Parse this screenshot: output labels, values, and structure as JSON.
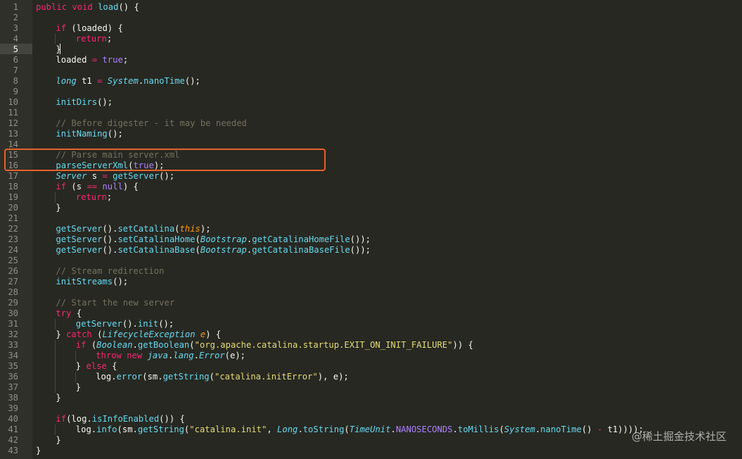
{
  "editor": {
    "active_line": 5,
    "highlight_lines": [
      15,
      16
    ],
    "watermark": "@稀土掘金技术社区",
    "lines": [
      {
        "n": "1",
        "indent": 0,
        "tokens": [
          [
            "kw",
            "public"
          ],
          [
            "pl",
            " "
          ],
          [
            "kw",
            "void"
          ],
          [
            "pl",
            " "
          ],
          [
            "fn",
            "load"
          ],
          [
            "pl",
            "() {"
          ]
        ]
      },
      {
        "n": "2",
        "indent": 0,
        "tokens": []
      },
      {
        "n": "3",
        "indent": 1,
        "tokens": [
          [
            "kw",
            "if"
          ],
          [
            "pl",
            " (loaded) {"
          ]
        ]
      },
      {
        "n": "4",
        "indent": 2,
        "tokens": [
          [
            "kw",
            "return"
          ],
          [
            "pl",
            ";"
          ]
        ]
      },
      {
        "n": "5",
        "indent": 1,
        "tokens": [
          [
            "pl",
            "}"
          ]
        ]
      },
      {
        "n": "6",
        "indent": 1,
        "tokens": [
          [
            "pl",
            "loaded "
          ],
          [
            "kw",
            "="
          ],
          [
            "pl",
            " "
          ],
          [
            "cn",
            "true"
          ],
          [
            "pl",
            ";"
          ]
        ]
      },
      {
        "n": "7",
        "indent": 0,
        "tokens": []
      },
      {
        "n": "8",
        "indent": 1,
        "tokens": [
          [
            "st",
            "long"
          ],
          [
            "pl",
            " t1 "
          ],
          [
            "kw",
            "="
          ],
          [
            "pl",
            " "
          ],
          [
            "st",
            "System"
          ],
          [
            "pl",
            "."
          ],
          [
            "fn",
            "nanoTime"
          ],
          [
            "pl",
            "();"
          ]
        ]
      },
      {
        "n": "9",
        "indent": 0,
        "tokens": []
      },
      {
        "n": "10",
        "indent": 1,
        "tokens": [
          [
            "fn",
            "initDirs"
          ],
          [
            "pl",
            "();"
          ]
        ]
      },
      {
        "n": "11",
        "indent": 0,
        "tokens": []
      },
      {
        "n": "12",
        "indent": 1,
        "tokens": [
          [
            "cm",
            "// Before digester - it may be needed"
          ]
        ]
      },
      {
        "n": "13",
        "indent": 1,
        "tokens": [
          [
            "fn",
            "initNaming"
          ],
          [
            "pl",
            "();"
          ]
        ]
      },
      {
        "n": "14",
        "indent": 0,
        "tokens": []
      },
      {
        "n": "15",
        "indent": 1,
        "tokens": [
          [
            "cm",
            "// Parse main server.xml"
          ]
        ]
      },
      {
        "n": "16",
        "indent": 1,
        "tokens": [
          [
            "fn",
            "parseServerXml"
          ],
          [
            "pl",
            "("
          ],
          [
            "cn",
            "true"
          ],
          [
            "pl",
            ");"
          ]
        ]
      },
      {
        "n": "17",
        "indent": 1,
        "tokens": [
          [
            "st",
            "Server"
          ],
          [
            "pl",
            " s "
          ],
          [
            "kw",
            "="
          ],
          [
            "pl",
            " "
          ],
          [
            "fn",
            "getServer"
          ],
          [
            "pl",
            "();"
          ]
        ]
      },
      {
        "n": "18",
        "indent": 1,
        "tokens": [
          [
            "kw",
            "if"
          ],
          [
            "pl",
            " (s "
          ],
          [
            "kw",
            "=="
          ],
          [
            "pl",
            " "
          ],
          [
            "cn",
            "null"
          ],
          [
            "pl",
            ") {"
          ]
        ]
      },
      {
        "n": "19",
        "indent": 2,
        "tokens": [
          [
            "kw",
            "return"
          ],
          [
            "pl",
            ";"
          ]
        ]
      },
      {
        "n": "20",
        "indent": 1,
        "tokens": [
          [
            "pl",
            "}"
          ]
        ]
      },
      {
        "n": "21",
        "indent": 0,
        "tokens": []
      },
      {
        "n": "22",
        "indent": 1,
        "tokens": [
          [
            "fn",
            "getServer"
          ],
          [
            "pl",
            "()."
          ],
          [
            "fn",
            "setCatalina"
          ],
          [
            "pl",
            "("
          ],
          [
            "pr",
            "this"
          ],
          [
            "pl",
            ");"
          ]
        ]
      },
      {
        "n": "23",
        "indent": 1,
        "tokens": [
          [
            "fn",
            "getServer"
          ],
          [
            "pl",
            "()."
          ],
          [
            "fn",
            "setCatalinaHome"
          ],
          [
            "pl",
            "("
          ],
          [
            "st",
            "Bootstrap"
          ],
          [
            "pl",
            "."
          ],
          [
            "fn",
            "getCatalinaHomeFile"
          ],
          [
            "pl",
            "());"
          ]
        ]
      },
      {
        "n": "24",
        "indent": 1,
        "tokens": [
          [
            "fn",
            "getServer"
          ],
          [
            "pl",
            "()."
          ],
          [
            "fn",
            "setCatalinaBase"
          ],
          [
            "pl",
            "("
          ],
          [
            "st",
            "Bootstrap"
          ],
          [
            "pl",
            "."
          ],
          [
            "fn",
            "getCatalinaBaseFile"
          ],
          [
            "pl",
            "());"
          ]
        ]
      },
      {
        "n": "25",
        "indent": 0,
        "tokens": []
      },
      {
        "n": "26",
        "indent": 1,
        "tokens": [
          [
            "cm",
            "// Stream redirection"
          ]
        ]
      },
      {
        "n": "27",
        "indent": 1,
        "tokens": [
          [
            "fn",
            "initStreams"
          ],
          [
            "pl",
            "();"
          ]
        ]
      },
      {
        "n": "28",
        "indent": 0,
        "tokens": []
      },
      {
        "n": "29",
        "indent": 1,
        "tokens": [
          [
            "cm",
            "// Start the new server"
          ]
        ]
      },
      {
        "n": "30",
        "indent": 1,
        "tokens": [
          [
            "kw",
            "try"
          ],
          [
            "pl",
            " {"
          ]
        ]
      },
      {
        "n": "31",
        "indent": 2,
        "tokens": [
          [
            "fn",
            "getServer"
          ],
          [
            "pl",
            "()."
          ],
          [
            "fn",
            "init"
          ],
          [
            "pl",
            "();"
          ]
        ]
      },
      {
        "n": "32",
        "indent": 1,
        "tokens": [
          [
            "pl",
            "} "
          ],
          [
            "kw",
            "catch"
          ],
          [
            "pl",
            " ("
          ],
          [
            "st",
            "LifecycleException"
          ],
          [
            "pl",
            " "
          ],
          [
            "pr",
            "e"
          ],
          [
            "pl",
            ") {"
          ]
        ]
      },
      {
        "n": "33",
        "indent": 2,
        "tokens": [
          [
            "kw",
            "if"
          ],
          [
            "pl",
            " ("
          ],
          [
            "st",
            "Boolean"
          ],
          [
            "pl",
            "."
          ],
          [
            "fn",
            "getBoolean"
          ],
          [
            "pl",
            "("
          ],
          [
            "str",
            "\"org.apache.catalina.startup.EXIT_ON_INIT_FAILURE\""
          ],
          [
            "pl",
            ")) {"
          ]
        ]
      },
      {
        "n": "34",
        "indent": 3,
        "tokens": [
          [
            "kw",
            "throw"
          ],
          [
            "pl",
            " "
          ],
          [
            "kw",
            "new"
          ],
          [
            "pl",
            " "
          ],
          [
            "st",
            "java"
          ],
          [
            "pl",
            "."
          ],
          [
            "st",
            "lang"
          ],
          [
            "pl",
            "."
          ],
          [
            "st",
            "Error"
          ],
          [
            "pl",
            "(e);"
          ]
        ]
      },
      {
        "n": "35",
        "indent": 2,
        "tokens": [
          [
            "pl",
            "} "
          ],
          [
            "kw",
            "else"
          ],
          [
            "pl",
            " {"
          ]
        ]
      },
      {
        "n": "36",
        "indent": 3,
        "tokens": [
          [
            "pl",
            "log."
          ],
          [
            "fn",
            "error"
          ],
          [
            "pl",
            "(sm."
          ],
          [
            "fn",
            "getString"
          ],
          [
            "pl",
            "("
          ],
          [
            "str",
            "\"catalina.initError\""
          ],
          [
            "pl",
            "), e);"
          ]
        ]
      },
      {
        "n": "37",
        "indent": 2,
        "tokens": [
          [
            "pl",
            "}"
          ]
        ]
      },
      {
        "n": "38",
        "indent": 1,
        "tokens": [
          [
            "pl",
            "}"
          ]
        ]
      },
      {
        "n": "39",
        "indent": 0,
        "tokens": []
      },
      {
        "n": "40",
        "indent": 1,
        "tokens": [
          [
            "kw",
            "if"
          ],
          [
            "pl",
            "(log."
          ],
          [
            "fn",
            "isInfoEnabled"
          ],
          [
            "pl",
            "()) {"
          ]
        ]
      },
      {
        "n": "41",
        "indent": 2,
        "tokens": [
          [
            "pl",
            "log."
          ],
          [
            "fn",
            "info"
          ],
          [
            "pl",
            "(sm."
          ],
          [
            "fn",
            "getString"
          ],
          [
            "pl",
            "("
          ],
          [
            "str",
            "\"catalina.init\""
          ],
          [
            "pl",
            ", "
          ],
          [
            "st",
            "Long"
          ],
          [
            "pl",
            "."
          ],
          [
            "fn",
            "toString"
          ],
          [
            "pl",
            "("
          ],
          [
            "st",
            "TimeUnit"
          ],
          [
            "pl",
            "."
          ],
          [
            "cn",
            "NANOSECONDS"
          ],
          [
            "pl",
            "."
          ],
          [
            "fn",
            "toMillis"
          ],
          [
            "pl",
            "("
          ],
          [
            "st",
            "System"
          ],
          [
            "pl",
            "."
          ],
          [
            "fn",
            "nanoTime"
          ],
          [
            "pl",
            "() "
          ],
          [
            "kw",
            "-"
          ],
          [
            "pl",
            " t1))));"
          ]
        ]
      },
      {
        "n": "42",
        "indent": 1,
        "tokens": [
          [
            "pl",
            "}"
          ]
        ]
      },
      {
        "n": "43",
        "indent": 0,
        "tokens": [
          [
            "pl",
            "}"
          ]
        ]
      }
    ]
  }
}
